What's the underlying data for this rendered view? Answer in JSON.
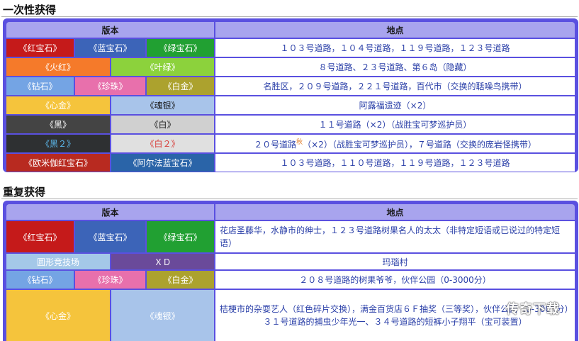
{
  "section1": {
    "title": "一次性获得",
    "header": {
      "version": "版本",
      "location": "地点"
    },
    "rows": [
      {
        "versions": [
          "《红宝石》",
          "《蓝宝石》",
          "《绿宝石》"
        ],
        "location": "１０３号道路，１０４号道路，１１９号道路，１２３号道路"
      },
      {
        "versions": [
          "《火红》",
          "《叶绿》"
        ],
        "location": "８号道路、２３号道路、第６岛（隐藏）"
      },
      {
        "versions": [
          "《钻石》",
          "《珍珠》",
          "《白金》"
        ],
        "location": "名胜区，２０９号道路，２２１号道路，百代市（交换的聒噪鸟携带）"
      },
      {
        "versions": [
          "《心金》",
          "《魂银》"
        ],
        "location": "阿露福遗迹（×2）"
      },
      {
        "versions": [
          "《黑》",
          "《白》"
        ],
        "location": "１１号道路（×2）（战胜宝可梦巡护员）"
      },
      {
        "versions": [
          "《黑２》",
          "《白２》"
        ],
        "location_a": "２０号道路",
        "location_sup": "秋",
        "location_b": "（×2）（战胜宝可梦巡护员），７号道路（交换的庞岩怪携带）"
      },
      {
        "versions": [
          "《欧米伽红宝石》",
          "《阿尔法蓝宝石》"
        ],
        "location": "１０３号道路，１１０号道路，１１９号道路，１２３号道路"
      }
    ]
  },
  "section2": {
    "title": "重复获得",
    "header": {
      "version": "版本",
      "location": "地点"
    },
    "rows": [
      {
        "versions": [
          "《红宝石》",
          "《蓝宝石》",
          "《绿宝石》"
        ],
        "location": "花店圣藤华，水静市的绅士，１２３号道路树果名人的太太（非特定短语或已说过的特定短语）"
      },
      {
        "versions": [
          "圆形竞技场",
          "ＸＤ"
        ],
        "location": "玛瑙村"
      },
      {
        "versions": [
          "《钻石》",
          "《珍珠》",
          "《白金》"
        ],
        "location": "２０８号道路的树果爷爷，伙伴公园（0-3000分）"
      },
      {
        "versions": [
          "《心金》",
          "《魂银》"
        ],
        "location_lines": [
          "桔梗市的杂耍艺人（红色碎片交换），满金百货店６Ｆ抽奖（三等奖），伙伴公园（0-3000分）",
          "３１号道路的捕虫少年光一、３４号道路的短裤小子翔平（宝可装置）"
        ]
      }
    ]
  },
  "watermark": "传奇下载"
}
